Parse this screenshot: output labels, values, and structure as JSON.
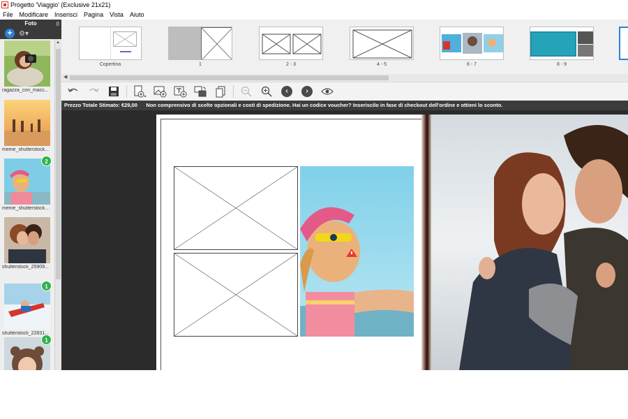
{
  "window": {
    "title": "Progetto 'Viaggio' (Exclusive 21x21)"
  },
  "menu": [
    "File",
    "Modificare",
    "Inserisci",
    "Pagina",
    "Vista",
    "Aiuto"
  ],
  "sidebar": {
    "header": "Foto",
    "grip": "ll",
    "add_label": "+",
    "photos": [
      {
        "name": "ragazza_con_macc...",
        "badge": null
      },
      {
        "name": "meme_shutterstock...",
        "badge": null
      },
      {
        "name": "meme_shutterstock...",
        "badge": "2"
      },
      {
        "name": "shutterstock_25909...",
        "badge": null
      },
      {
        "name": "shutterstock_22831...",
        "badge": "1"
      },
      {
        "name": "",
        "badge": "1"
      }
    ]
  },
  "pages": [
    {
      "label": "Copertina"
    },
    {
      "label": "1"
    },
    {
      "label": "2 - 3"
    },
    {
      "label": "4 - 5"
    },
    {
      "label": "6 - 7"
    },
    {
      "label": "8 - 9"
    }
  ],
  "toolbar": {
    "icons": [
      "undo-icon",
      "redo-icon",
      "save-icon",
      "add-page-icon",
      "add-photo-icon",
      "add-text-icon",
      "swap-photos-icon",
      "copy-page-icon",
      "zoom-out-icon",
      "zoom-in-icon",
      "prev-page-icon",
      "next-page-icon",
      "preview-icon"
    ]
  },
  "info": {
    "price_label": "Prezzo Totale Stimato: €29,00",
    "note": "Non comprensivo di scelte opzionali e costi di spedizione. Hai un codice voucher? Inseriscilo in fase di checkout dell'ordine e ottieni lo sconto."
  },
  "colors": {
    "accent": "#2d7fd6",
    "badge": "#2fb34a",
    "warning": "#e53935",
    "dark": "#3c3c3c"
  }
}
